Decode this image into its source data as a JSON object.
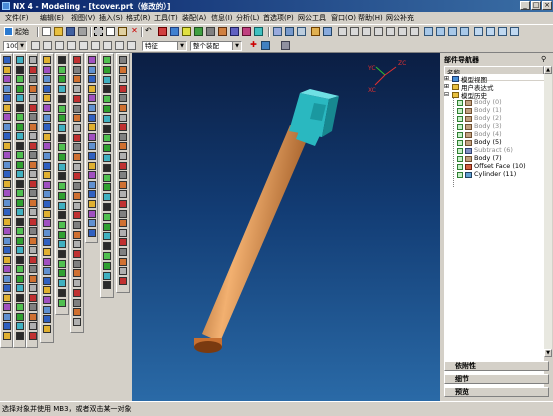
{
  "window": {
    "title": "NX 4 - Modeling - [tcover.prt（修改的）]",
    "min_label": "_",
    "max_label": "□",
    "close_label": "×"
  },
  "menu": [
    "文件(F)",
    "编辑(E)",
    "视图(V)",
    "插入(S)",
    "格式(R)",
    "工具(T)",
    "装配(A)",
    "信息(I)",
    "分析(L)",
    "首选项(P)",
    "网公工具",
    "窗口(O)",
    "帮助(H)",
    "网公补充"
  ],
  "toolbar": {
    "start_label": "起始",
    "zoom_value": "100",
    "filter_value": "特征",
    "scope_value": "整个装配"
  },
  "viewport": {
    "axis_x": "XC",
    "axis_y": "YC",
    "axis_z": "ZC"
  },
  "navigator": {
    "title": "部件导航器",
    "column_header": "名称",
    "items": [
      {
        "label": "模型视图",
        "dim": false
      },
      {
        "label": "用户表达式",
        "dim": false
      },
      {
        "label": "模型历史",
        "dim": false
      },
      {
        "label": "Body (0)",
        "dim": true
      },
      {
        "label": "Body (1)",
        "dim": true
      },
      {
        "label": "Body (2)",
        "dim": true
      },
      {
        "label": "Body (3)",
        "dim": true
      },
      {
        "label": "Body (4)",
        "dim": true
      },
      {
        "label": "Body (5)",
        "dim": false
      },
      {
        "label": "Subtract (6)",
        "dim": true
      },
      {
        "label": "Body (7)",
        "dim": false
      },
      {
        "label": "Offset Face (10)",
        "dim": false
      },
      {
        "label": "Cylinder (11)",
        "dim": false
      }
    ],
    "panels": [
      "依附性",
      "细节",
      "预览"
    ]
  },
  "status": {
    "prompt": "选择对象并使用 MB3，或者双击某一对象"
  },
  "colors": {
    "title_start": "#0a246a",
    "title_end": "#3a6ea5",
    "viewport_top": "#0b1e43",
    "viewport_bottom": "#2a6aa7",
    "shaft": "#d9863a",
    "head": "#2ab8c0"
  }
}
